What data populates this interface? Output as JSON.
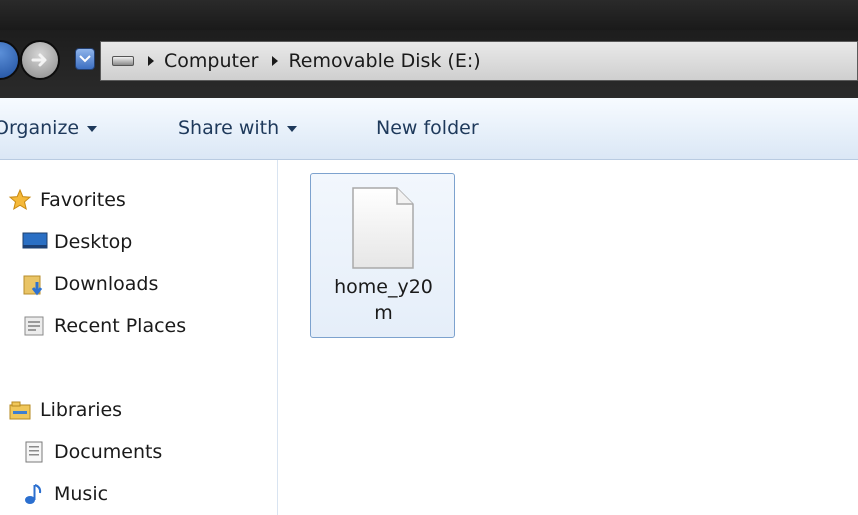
{
  "address_bar": {
    "crumbs": [
      "Computer",
      "Removable Disk (E:)"
    ]
  },
  "toolbar": {
    "organize_label": "Organize",
    "share_label": "Share with",
    "new_folder_label": "New folder"
  },
  "nav": {
    "favorites": {
      "label": "Favorites",
      "items": [
        {
          "label": "Desktop",
          "icon": "desktop-icon"
        },
        {
          "label": "Downloads",
          "icon": "downloads-icon"
        },
        {
          "label": "Recent Places",
          "icon": "recent-places-icon"
        }
      ]
    },
    "libraries": {
      "label": "Libraries",
      "items": [
        {
          "label": "Documents",
          "icon": "documents-icon"
        },
        {
          "label": "Music",
          "icon": "music-icon"
        }
      ]
    }
  },
  "content": {
    "files": [
      {
        "name": "home_y20m",
        "icon": "generic-file-icon",
        "selected": true
      }
    ]
  },
  "colors": {
    "toolbar_text": "#1e395b",
    "selection_border": "#7da2ce",
    "chrome_dark": "#1d1d1d"
  }
}
